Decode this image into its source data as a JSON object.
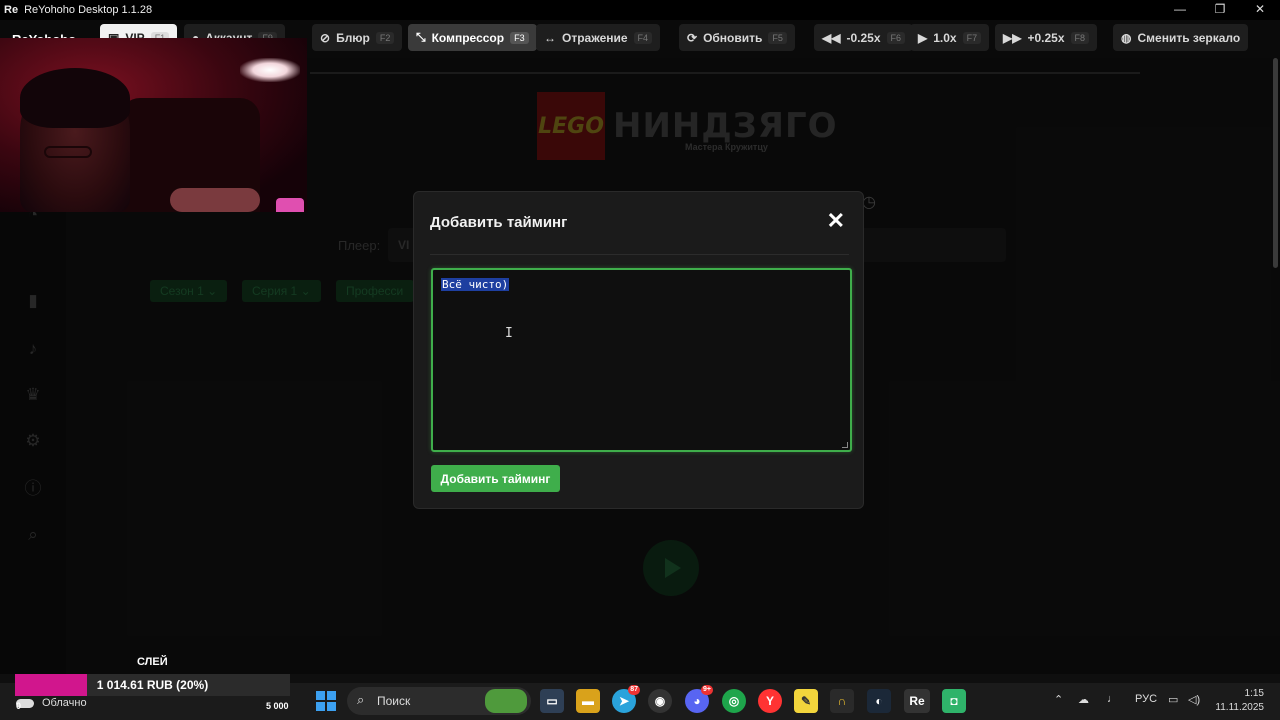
{
  "window": {
    "icon_label": "Re",
    "title": "ReYohoho Desktop 1.1.28",
    "min": "—",
    "max": "❐",
    "close": "✕"
  },
  "brand": "ReYohoho",
  "toolbar": {
    "vip": {
      "label": "VIP",
      "key": "F1"
    },
    "account": {
      "label": "Аккаунт",
      "key": "F9"
    },
    "blur": {
      "label": "Блюр",
      "key": "F2"
    },
    "compressor": {
      "label": "Компрессор",
      "key": "F3"
    },
    "mirror": {
      "label": "Отражение",
      "key": "F4"
    },
    "refresh": {
      "label": "Обновить",
      "key": "F5"
    },
    "speed_down": {
      "label": "-0.25x",
      "key": "F6"
    },
    "speed_normal": {
      "label": "1.0x",
      "key": "F7"
    },
    "speed_up": {
      "label": "+0.25x",
      "key": "F8"
    },
    "change_mirror": {
      "label": "Сменить зеркало"
    }
  },
  "page": {
    "logo_lego": "LEGO",
    "logo_title": "НИНДЗЯГО",
    "logo_subtitle": "Мастера Кружитцу",
    "player_label": "Плеер:",
    "player_value": "VI",
    "season_select": "Сезон 1",
    "episode_select": "Серия 1",
    "profession_select": "Професси"
  },
  "modal": {
    "title": "Добавить тайминг",
    "close": "✕",
    "textarea_value": "Всё чисто)",
    "submit": "Добавить тайминг"
  },
  "donation": {
    "name": "СЛЕЙ",
    "amount": "1 014.61 RUB (20%)",
    "progress_fraction": 0.2,
    "min": "0",
    "max": "5 000",
    "fill_color": "#d1168d"
  },
  "taskbar": {
    "weather": "Облачно",
    "search_label": "Поиск",
    "telegram_badge": "87",
    "discord_badge": "9+",
    "lang": "РУС",
    "time": "1:15",
    "date": "11.11.2025"
  },
  "colors": {
    "accent_green": "#3fae4b",
    "selection_blue": "#1e3fa0"
  }
}
